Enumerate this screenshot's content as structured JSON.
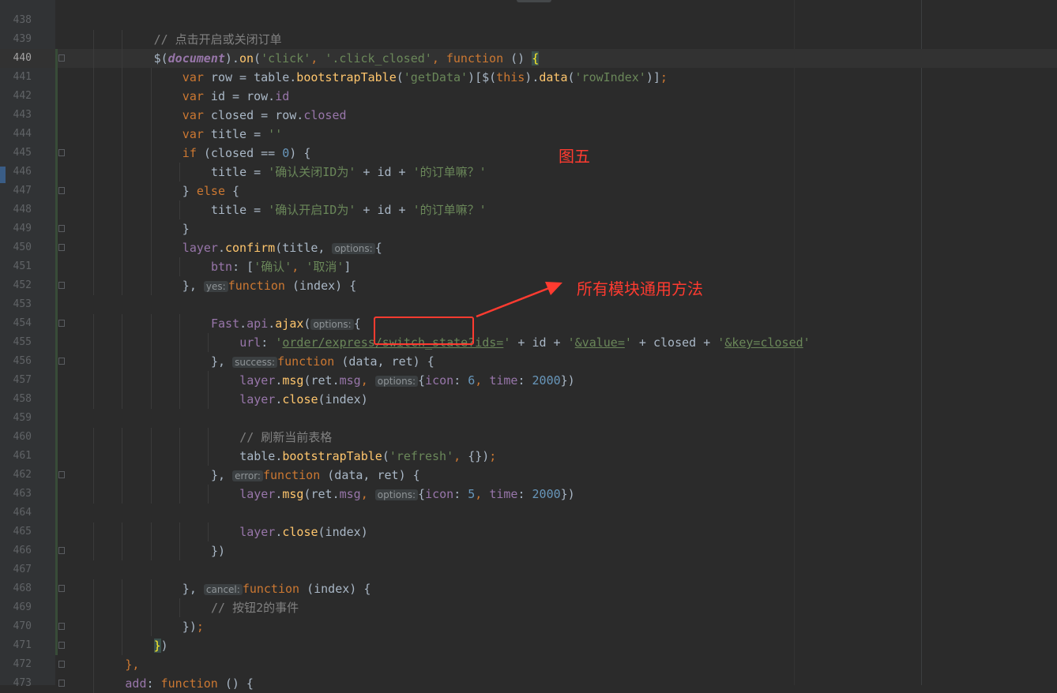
{
  "editor": {
    "line_numbers": [
      "438",
      "439",
      "440",
      "441",
      "442",
      "443",
      "444",
      "445",
      "446",
      "447",
      "448",
      "449",
      "450",
      "451",
      "452",
      "453",
      "454",
      "455",
      "456",
      "457",
      "458",
      "459",
      "460",
      "461",
      "462",
      "463",
      "464",
      "465",
      "466",
      "467",
      "468",
      "469",
      "470",
      "471",
      "472",
      "473"
    ],
    "current_line": "440",
    "code_lines": [
      [],
      [
        {
          "t": "// 点击开启或关闭订单",
          "c": "comment"
        }
      ],
      [
        {
          "t": "$(",
          "c": "p"
        },
        {
          "t": "document",
          "c": "doc"
        },
        {
          "t": ").",
          "c": "p"
        },
        {
          "t": "on",
          "c": "fn"
        },
        {
          "t": "(",
          "c": "p"
        },
        {
          "t": "'click'",
          "c": "str"
        },
        {
          "t": ", ",
          "c": "kw"
        },
        {
          "t": "'.click_closed'",
          "c": "str"
        },
        {
          "t": ", ",
          "c": "kw"
        },
        {
          "t": "function",
          "c": "kw"
        },
        {
          "t": " () ",
          "c": "p"
        },
        {
          "t": "{",
          "c": "bm"
        }
      ],
      [
        {
          "t": "var",
          "c": "kw"
        },
        {
          "t": " row = table.",
          "c": "p"
        },
        {
          "t": "bootstrapTable",
          "c": "fn"
        },
        {
          "t": "(",
          "c": "p"
        },
        {
          "t": "'getData'",
          "c": "str"
        },
        {
          "t": ")[$(",
          "c": "p"
        },
        {
          "t": "this",
          "c": "kw"
        },
        {
          "t": ").",
          "c": "p"
        },
        {
          "t": "data",
          "c": "fn"
        },
        {
          "t": "(",
          "c": "p"
        },
        {
          "t": "'rowIndex'",
          "c": "str"
        },
        {
          "t": ")]",
          "c": "p"
        },
        {
          "t": ";",
          "c": "kw"
        }
      ],
      [
        {
          "t": "var",
          "c": "kw"
        },
        {
          "t": " id = row.",
          "c": "p"
        },
        {
          "t": "id",
          "c": "prop"
        }
      ],
      [
        {
          "t": "var",
          "c": "kw"
        },
        {
          "t": " closed = row.",
          "c": "p"
        },
        {
          "t": "closed",
          "c": "prop"
        }
      ],
      [
        {
          "t": "var",
          "c": "kw"
        },
        {
          "t": " title = ",
          "c": "p"
        },
        {
          "t": "''",
          "c": "str"
        }
      ],
      [
        {
          "t": "if",
          "c": "kw"
        },
        {
          "t": " (closed == ",
          "c": "p"
        },
        {
          "t": "0",
          "c": "num"
        },
        {
          "t": ") {",
          "c": "p"
        }
      ],
      [
        {
          "t": "title = ",
          "c": "p"
        },
        {
          "t": "'确认关闭ID为'",
          "c": "str"
        },
        {
          "t": " + id + ",
          "c": "p"
        },
        {
          "t": "'的订单嘛？'",
          "c": "str"
        }
      ],
      [
        {
          "t": "} ",
          "c": "p"
        },
        {
          "t": "else",
          "c": "kw"
        },
        {
          "t": " {",
          "c": "p"
        }
      ],
      [
        {
          "t": "title = ",
          "c": "p"
        },
        {
          "t": "'确认开启ID为'",
          "c": "str"
        },
        {
          "t": " + id + ",
          "c": "p"
        },
        {
          "t": "'的订单嘛？'",
          "c": "str"
        }
      ],
      [
        {
          "t": "}",
          "c": "p"
        }
      ],
      [
        {
          "t": "layer",
          "c": "prop"
        },
        {
          "t": ".",
          "c": "p"
        },
        {
          "t": "confirm",
          "c": "fn"
        },
        {
          "t": "(title, ",
          "c": "p"
        },
        {
          "t": "options:",
          "c": "hint"
        },
        {
          "t": "{",
          "c": "p"
        }
      ],
      [
        {
          "t": "btn",
          "c": "prop"
        },
        {
          "t": ": [",
          "c": "p"
        },
        {
          "t": "'确认'",
          "c": "str"
        },
        {
          "t": ", ",
          "c": "kw"
        },
        {
          "t": "'取消'",
          "c": "str"
        },
        {
          "t": "]",
          "c": "p"
        }
      ],
      [
        {
          "t": "}, ",
          "c": "p"
        },
        {
          "t": "yes:",
          "c": "hint"
        },
        {
          "t": "function",
          "c": "kw"
        },
        {
          "t": " (index) {",
          "c": "p"
        }
      ],
      [],
      [
        {
          "t": "Fast",
          "c": "prop"
        },
        {
          "t": ".",
          "c": "p"
        },
        {
          "t": "api",
          "c": "prop"
        },
        {
          "t": ".",
          "c": "p"
        },
        {
          "t": "ajax",
          "c": "fn"
        },
        {
          "t": "(",
          "c": "p"
        },
        {
          "t": "options:",
          "c": "hint"
        },
        {
          "t": "{",
          "c": "p"
        }
      ],
      [
        {
          "t": "url",
          "c": "prop"
        },
        {
          "t": ": ",
          "c": "p"
        },
        {
          "t": "'",
          "c": "str"
        },
        {
          "t": "order/express/switch_state?ids=",
          "c": "url"
        },
        {
          "t": "'",
          "c": "str"
        },
        {
          "t": " + id + ",
          "c": "p"
        },
        {
          "t": "'",
          "c": "str"
        },
        {
          "t": "&value=",
          "c": "url"
        },
        {
          "t": "'",
          "c": "str"
        },
        {
          "t": " + closed + ",
          "c": "p"
        },
        {
          "t": "'",
          "c": "str"
        },
        {
          "t": "&key=closed",
          "c": "url"
        },
        {
          "t": "'",
          "c": "str"
        }
      ],
      [
        {
          "t": "}, ",
          "c": "p"
        },
        {
          "t": "success:",
          "c": "hint"
        },
        {
          "t": "function",
          "c": "kw"
        },
        {
          "t": " (data, ret) {",
          "c": "p"
        }
      ],
      [
        {
          "t": "layer",
          "c": "prop"
        },
        {
          "t": ".",
          "c": "p"
        },
        {
          "t": "msg",
          "c": "fn"
        },
        {
          "t": "(ret.",
          "c": "p"
        },
        {
          "t": "msg",
          "c": "prop"
        },
        {
          "t": ", ",
          "c": "kw"
        },
        {
          "t": "options:",
          "c": "hint"
        },
        {
          "t": "{",
          "c": "p"
        },
        {
          "t": "icon",
          "c": "prop"
        },
        {
          "t": ": ",
          "c": "p"
        },
        {
          "t": "6",
          "c": "num"
        },
        {
          "t": ", ",
          "c": "kw"
        },
        {
          "t": "time",
          "c": "prop"
        },
        {
          "t": ": ",
          "c": "p"
        },
        {
          "t": "2000",
          "c": "num"
        },
        {
          "t": "})",
          "c": "p"
        }
      ],
      [
        {
          "t": "layer",
          "c": "prop"
        },
        {
          "t": ".",
          "c": "p"
        },
        {
          "t": "close",
          "c": "fn"
        },
        {
          "t": "(index)",
          "c": "p"
        }
      ],
      [],
      [
        {
          "t": "// 刷新当前表格",
          "c": "comment"
        }
      ],
      [
        {
          "t": "table.",
          "c": "p"
        },
        {
          "t": "bootstrapTable",
          "c": "fn"
        },
        {
          "t": "(",
          "c": "p"
        },
        {
          "t": "'refresh'",
          "c": "str"
        },
        {
          "t": ", ",
          "c": "kw"
        },
        {
          "t": "{})",
          "c": "p"
        },
        {
          "t": ";",
          "c": "kw"
        }
      ],
      [
        {
          "t": "}, ",
          "c": "p"
        },
        {
          "t": "error:",
          "c": "hint"
        },
        {
          "t": "function",
          "c": "kw"
        },
        {
          "t": " (data, ret) {",
          "c": "p"
        }
      ],
      [
        {
          "t": "layer",
          "c": "prop"
        },
        {
          "t": ".",
          "c": "p"
        },
        {
          "t": "msg",
          "c": "fn"
        },
        {
          "t": "(ret.",
          "c": "p"
        },
        {
          "t": "msg",
          "c": "prop"
        },
        {
          "t": ", ",
          "c": "kw"
        },
        {
          "t": "options:",
          "c": "hint"
        },
        {
          "t": "{",
          "c": "p"
        },
        {
          "t": "icon",
          "c": "prop"
        },
        {
          "t": ": ",
          "c": "p"
        },
        {
          "t": "5",
          "c": "num"
        },
        {
          "t": ", ",
          "c": "kw"
        },
        {
          "t": "time",
          "c": "prop"
        },
        {
          "t": ": ",
          "c": "p"
        },
        {
          "t": "2000",
          "c": "num"
        },
        {
          "t": "})",
          "c": "p"
        }
      ],
      [],
      [
        {
          "t": "layer",
          "c": "prop"
        },
        {
          "t": ".",
          "c": "p"
        },
        {
          "t": "close",
          "c": "fn"
        },
        {
          "t": "(index)",
          "c": "p"
        }
      ],
      [
        {
          "t": "})",
          "c": "p"
        }
      ],
      [],
      [
        {
          "t": "}, ",
          "c": "p"
        },
        {
          "t": "cancel:",
          "c": "hint"
        },
        {
          "t": "function",
          "c": "kw"
        },
        {
          "t": " (index) {",
          "c": "p"
        }
      ],
      [
        {
          "t": "// 按钮2的事件",
          "c": "comment"
        }
      ],
      [
        {
          "t": "})",
          "c": "p"
        },
        {
          "t": ";",
          "c": "kw"
        }
      ],
      [
        {
          "t": "}",
          "c": "bm"
        },
        {
          "t": ")",
          "c": "p"
        }
      ],
      [
        {
          "t": "},",
          "c": "kw"
        }
      ],
      [
        {
          "t": "add",
          "c": "prop"
        },
        {
          "t": ": ",
          "c": "p"
        },
        {
          "t": "function",
          "c": "kw"
        },
        {
          "t": " () {",
          "c": "p"
        }
      ]
    ]
  },
  "annotations": {
    "figure_label": "图五",
    "arrow_label": "所有模块通用方法"
  },
  "colors": {
    "kw": "#cc7832",
    "str": "#6a8759",
    "fn": "#ffc66d",
    "prop": "#9876aa",
    "num": "#6897bb",
    "comment": "#808080",
    "p": "#a9b7c6",
    "doc": "#9876aa",
    "url": "#6a8759",
    "bm": "#ffef28",
    "annotation": "#ff3b30"
  }
}
